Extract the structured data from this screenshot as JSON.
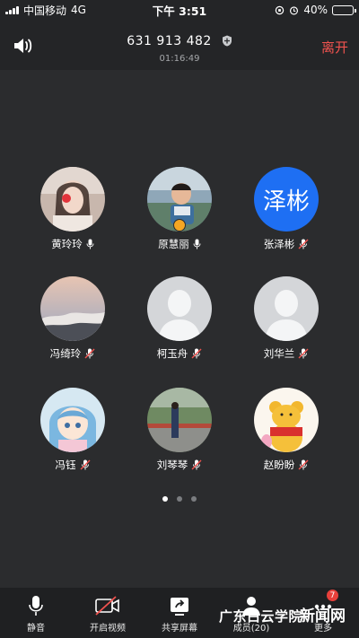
{
  "status_bar": {
    "carrier": "中国移动",
    "network": "4G",
    "time": "下午 3:51",
    "battery": "40%",
    "battery_level": 0.4
  },
  "header": {
    "meeting_id": "631 913 482",
    "duration": "01:16:49",
    "leave_label": "离开"
  },
  "participants": [
    {
      "name": "黄玲玲",
      "mic": "on",
      "avatar": "photo"
    },
    {
      "name": "原慧丽",
      "mic": "on",
      "avatar": "photo",
      "host": true
    },
    {
      "name": "张泽彬",
      "mic": "muted",
      "avatar": "text",
      "avatar_text": "泽彬"
    },
    {
      "name": "冯绮玲",
      "mic": "muted",
      "avatar": "photo"
    },
    {
      "name": "柯玉舟",
      "mic": "muted",
      "avatar": "placeholder"
    },
    {
      "name": "刘华兰",
      "mic": "muted",
      "avatar": "placeholder"
    },
    {
      "name": "冯钰",
      "mic": "muted",
      "avatar": "photo"
    },
    {
      "name": "刘琴琴",
      "mic": "muted",
      "avatar": "photo"
    },
    {
      "name": "赵盼盼",
      "mic": "muted",
      "avatar": "photo"
    }
  ],
  "pagination": {
    "pages": 3,
    "current": 1
  },
  "toolbar": {
    "mute_label": "静音",
    "video_label": "开启视频",
    "share_label": "共享屏幕",
    "members_label": "成员(20)",
    "more_label": "更多",
    "more_badge": "7"
  },
  "watermark": {
    "text1": "广东白云学院",
    "text2": "新闻网"
  },
  "colors": {
    "background": "#2b2c2e",
    "leave": "#f2534f",
    "avatar_blue": "#1e6ff3",
    "badge_red": "#e8403b"
  }
}
